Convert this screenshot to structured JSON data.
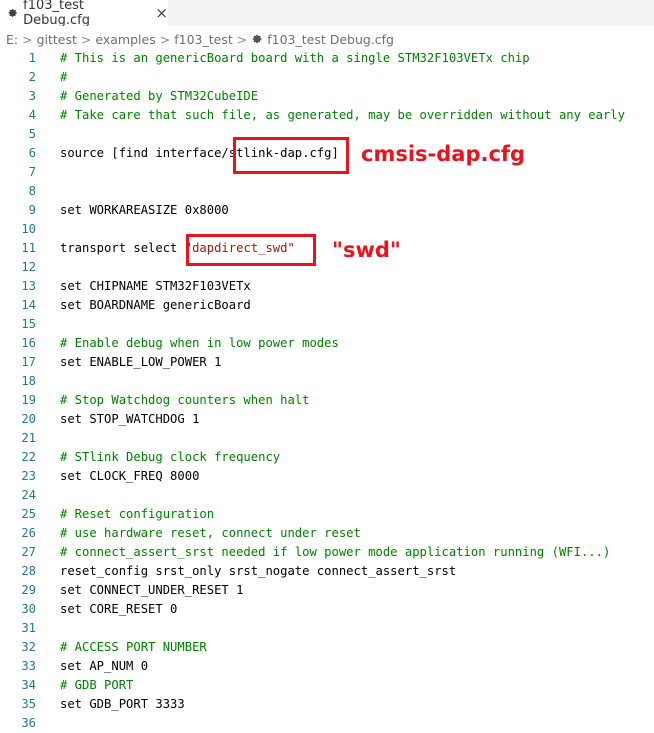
{
  "tab": {
    "title": "f103_test Debug.cfg",
    "close_glyph": "×",
    "icon": "gear-icon"
  },
  "breadcrumb": {
    "items": [
      "E:",
      "gittest",
      "examples",
      "f103_test"
    ],
    "file": "f103_test Debug.cfg",
    "separator": ">"
  },
  "editor": {
    "lines": [
      {
        "n": "1",
        "parts": [
          {
            "t": "# This is an genericBoard board with a single STM32F103VETx chip",
            "c": "comment"
          }
        ]
      },
      {
        "n": "2",
        "parts": [
          {
            "t": "#",
            "c": "comment"
          }
        ]
      },
      {
        "n": "3",
        "parts": [
          {
            "t": "# Generated by STM32CubeIDE",
            "c": "comment"
          }
        ]
      },
      {
        "n": "4",
        "parts": [
          {
            "t": "# Take care that such file, as generated, may be overridden without any early",
            "c": "comment"
          }
        ]
      },
      {
        "n": "5",
        "parts": []
      },
      {
        "n": "6",
        "parts": [
          {
            "t": "source [find interface/stlink-dap.cfg]",
            "c": "plain"
          }
        ]
      },
      {
        "n": "7",
        "parts": []
      },
      {
        "n": "8",
        "parts": []
      },
      {
        "n": "9",
        "parts": [
          {
            "t": "set WORKAREASIZE 0x8000",
            "c": "plain"
          }
        ]
      },
      {
        "n": "10",
        "parts": []
      },
      {
        "n": "11",
        "parts": [
          {
            "t": "transport select ",
            "c": "plain"
          },
          {
            "t": "\"dapdirect_swd\"",
            "c": "string"
          }
        ]
      },
      {
        "n": "12",
        "parts": []
      },
      {
        "n": "13",
        "parts": [
          {
            "t": "set CHIPNAME STM32F103VETx",
            "c": "plain"
          }
        ]
      },
      {
        "n": "14",
        "parts": [
          {
            "t": "set BOARDNAME genericBoard",
            "c": "plain"
          }
        ]
      },
      {
        "n": "15",
        "parts": []
      },
      {
        "n": "16",
        "parts": [
          {
            "t": "# Enable debug when in low power modes",
            "c": "comment"
          }
        ]
      },
      {
        "n": "17",
        "parts": [
          {
            "t": "set ENABLE_LOW_POWER 1",
            "c": "plain"
          }
        ]
      },
      {
        "n": "18",
        "parts": []
      },
      {
        "n": "19",
        "parts": [
          {
            "t": "# Stop Watchdog counters when halt",
            "c": "comment"
          }
        ]
      },
      {
        "n": "20",
        "parts": [
          {
            "t": "set STOP_WATCHDOG 1",
            "c": "plain"
          }
        ]
      },
      {
        "n": "21",
        "parts": []
      },
      {
        "n": "22",
        "parts": [
          {
            "t": "# STlink Debug clock frequency",
            "c": "comment"
          }
        ]
      },
      {
        "n": "23",
        "parts": [
          {
            "t": "set CLOCK_FREQ 8000",
            "c": "plain"
          }
        ]
      },
      {
        "n": "24",
        "parts": []
      },
      {
        "n": "25",
        "parts": [
          {
            "t": "# Reset configuration",
            "c": "comment"
          }
        ]
      },
      {
        "n": "26",
        "parts": [
          {
            "t": "# use hardware reset, connect under reset",
            "c": "comment"
          }
        ]
      },
      {
        "n": "27",
        "parts": [
          {
            "t": "# connect_assert_srst needed if low power mode application running (WFI...)",
            "c": "comment"
          }
        ]
      },
      {
        "n": "28",
        "parts": [
          {
            "t": "reset_config srst_only srst_nogate connect_assert_srst",
            "c": "plain"
          }
        ]
      },
      {
        "n": "29",
        "parts": [
          {
            "t": "set CONNECT_UNDER_RESET 1",
            "c": "plain"
          }
        ]
      },
      {
        "n": "30",
        "parts": [
          {
            "t": "set CORE_RESET 0",
            "c": "plain"
          }
        ]
      },
      {
        "n": "31",
        "parts": []
      },
      {
        "n": "32",
        "parts": [
          {
            "t": "# ACCESS PORT NUMBER",
            "c": "comment"
          }
        ]
      },
      {
        "n": "33",
        "parts": [
          {
            "t": "set AP_NUM 0",
            "c": "plain"
          }
        ]
      },
      {
        "n": "34",
        "parts": [
          {
            "t": "# GDB PORT",
            "c": "comment"
          }
        ]
      },
      {
        "n": "35",
        "parts": [
          {
            "t": "set GDB_PORT 3333",
            "c": "plain"
          }
        ]
      },
      {
        "n": "36",
        "parts": []
      }
    ]
  },
  "annotations": {
    "first": "cmsis-dap.cfg",
    "second": "\"swd\"",
    "color": "#e8131b"
  },
  "colors": {
    "comment": "#008000",
    "string": "#a31515",
    "line_number": "#237893"
  }
}
